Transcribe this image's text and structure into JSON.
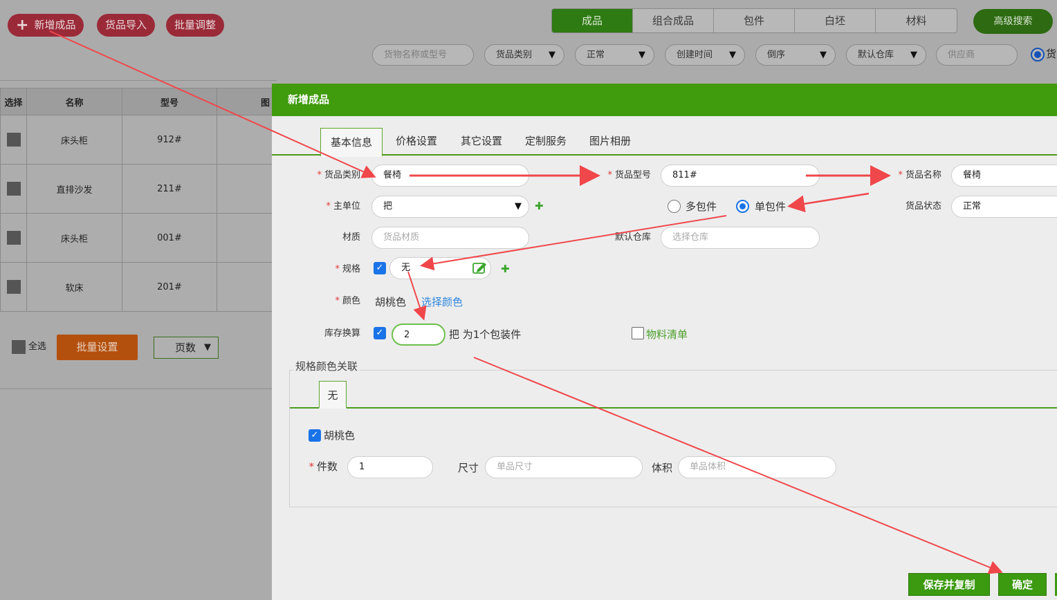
{
  "toolbar": {
    "add_label": "新增成品",
    "import_label": "货品导入",
    "batch_adjust_label": "批量调整",
    "advanced_search_label": "高级搜索"
  },
  "category_tabs": [
    "成品",
    "组合成品",
    "包件",
    "白坯",
    "材料"
  ],
  "filters": {
    "search_placeholder": "货物名称或型号",
    "category": "货品类别",
    "status": "正常",
    "sort_field": "创建时间",
    "sort_order": "倒序",
    "warehouse": "默认仓库",
    "supplier_placeholder": "供应商",
    "radio_cut_text": "货"
  },
  "table": {
    "headers": [
      "选择",
      "名称",
      "型号",
      "图"
    ],
    "rows": [
      {
        "name": "床头柜",
        "model": "912#"
      },
      {
        "name": "直排沙发",
        "model": "211#"
      },
      {
        "name": "床头柜",
        "model": "001#"
      },
      {
        "name": "软床",
        "model": "201#"
      }
    ],
    "select_all": "全选",
    "batch_settings": "批量设置",
    "pages": "页数"
  },
  "modal": {
    "title": "新增成品",
    "tabs": [
      "基本信息",
      "价格设置",
      "其它设置",
      "定制服务",
      "图片相册"
    ],
    "fields": {
      "category_label": "货品类别",
      "category_value": "餐椅",
      "model_label": "货品型号",
      "model_value": "811#",
      "name_label": "货品名称",
      "name_value": "餐椅",
      "unit_label": "主单位",
      "unit_value": "把",
      "multi_pkg": "多包件",
      "single_pkg": "单包件",
      "status_label": "货品状态",
      "status_value": "正常",
      "material_label": "材质",
      "material_placeholder": "货品材质",
      "warehouse_label": "默认仓库",
      "warehouse_placeholder": "选择仓库",
      "spec_label": "规格",
      "spec_value": "无",
      "color_label": "颜色",
      "color_value": "胡桃色",
      "choose_color": "选择颜色",
      "stock_label": "库存换算",
      "stock_value": "2",
      "stock_suffix": "把 为1个包装件",
      "bom_label": "物料清单"
    },
    "spec_color": {
      "legend": "规格颜色关联",
      "tab": "无",
      "color_check": "胡桃色",
      "pieces_label": "件数",
      "pieces_value": "1",
      "size_label": "尺寸",
      "size_placeholder": "单品尺寸",
      "volume_label": "体积",
      "volume_placeholder": "单品体积"
    },
    "buttons": {
      "save_copy": "保存并复制",
      "confirm": "确定"
    }
  },
  "colors": {
    "accent_green": "#409b0d",
    "annotation_arrow": "#f0474b",
    "checkbox_blue": "#1a73e8",
    "required_red": "#e03a3a"
  }
}
